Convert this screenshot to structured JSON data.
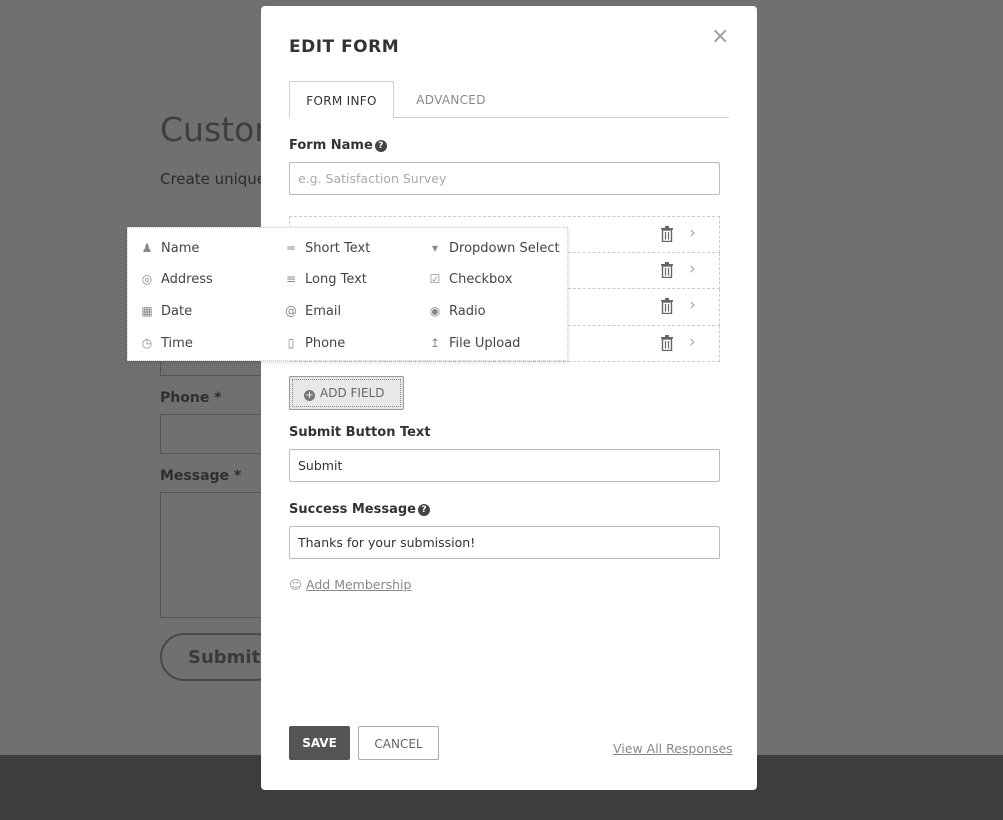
{
  "background": {
    "title": "Custon",
    "subtitle": "Create unique",
    "phone_label": "Phone *",
    "message_label": "Message *",
    "submit_label": "Submit"
  },
  "modal": {
    "title": "EDIT FORM",
    "close_icon": "×",
    "tabs": [
      {
        "label": "FORM INFO",
        "active": true
      },
      {
        "label": "ADVANCED",
        "active": false
      }
    ],
    "form_name": {
      "label": "Form Name",
      "placeholder": "e.g. Satisfaction Survey",
      "value": ""
    },
    "field_rows": 4,
    "add_field_label": "ADD FIELD",
    "submit_button_text": {
      "label": "Submit Button Text",
      "value": "Submit"
    },
    "success_message": {
      "label": "Success Message",
      "value": "Thanks for your submission!"
    },
    "add_membership_label": "Add Membership",
    "save_label": "SAVE",
    "cancel_label": "CANCEL",
    "view_all_label": "View All Responses"
  },
  "field_types": {
    "col1": [
      {
        "label": "Name",
        "icon": "person-icon"
      },
      {
        "label": "Address",
        "icon": "location-pin-icon"
      },
      {
        "label": "Date",
        "icon": "calendar-icon"
      },
      {
        "label": "Time",
        "icon": "clock-icon"
      }
    ],
    "col2": [
      {
        "label": "Short Text",
        "icon": "short-text-icon"
      },
      {
        "label": "Long Text",
        "icon": "long-text-icon"
      },
      {
        "label": "Email",
        "icon": "at-icon"
      },
      {
        "label": "Phone",
        "icon": "phone-icon"
      }
    ],
    "col3": [
      {
        "label": "Dropdown Select",
        "icon": "dropdown-icon"
      },
      {
        "label": "Checkbox",
        "icon": "checkbox-icon"
      },
      {
        "label": "Radio",
        "icon": "radio-icon"
      },
      {
        "label": "File Upload",
        "icon": "upload-icon"
      }
    ]
  },
  "colors": {
    "overlay_bg": "#707070",
    "footer_bg": "#3d3d3d",
    "save_bg": "#555555"
  }
}
